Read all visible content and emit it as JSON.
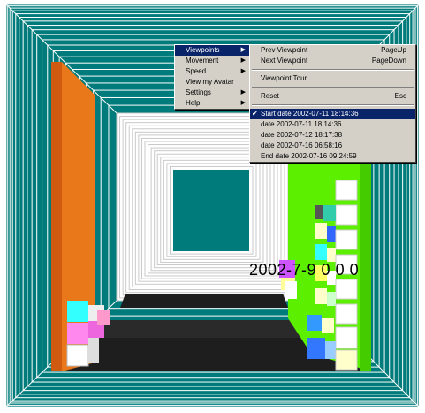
{
  "overlay": {
    "date_text": "2002-7-9 0 0 0"
  },
  "main_menu": {
    "items": [
      {
        "label": "Viewpoints",
        "submenu": true,
        "selected": true
      },
      {
        "label": "Movement",
        "submenu": true
      },
      {
        "label": "Speed",
        "submenu": true
      },
      {
        "label": "View my Avatar",
        "submenu": false
      },
      {
        "label": "Settings",
        "submenu": true
      },
      {
        "label": "Help",
        "submenu": true
      }
    ]
  },
  "viewpoints_menu": {
    "prev": {
      "label": "Prev Viewpoint",
      "shortcut": "PageUp"
    },
    "next": {
      "label": "Next Viewpoint",
      "shortcut": "PageDown"
    },
    "tour": {
      "label": "Viewpoint Tour"
    },
    "reset": {
      "label": "Reset",
      "shortcut": "Esc"
    },
    "dates": [
      {
        "label": "Start date 2002-07-11 18:14:36",
        "checked": true
      },
      {
        "label": "date 2002-07-11 18:14:36",
        "checked": false
      },
      {
        "label": "date 2002-07-12 18:17:38",
        "checked": false
      },
      {
        "label": "date 2002-07-16 06:58:16",
        "checked": false
      },
      {
        "label": "End date 2002-07-16 09:24:59",
        "checked": false
      }
    ]
  },
  "colors": {
    "wall": "#007b7b",
    "orange_panel": "#e87010",
    "green_panel": "#66ff00",
    "floor": "#222222",
    "menu_bg": "#d4d0c8",
    "menu_highlight": "#0a246a"
  }
}
